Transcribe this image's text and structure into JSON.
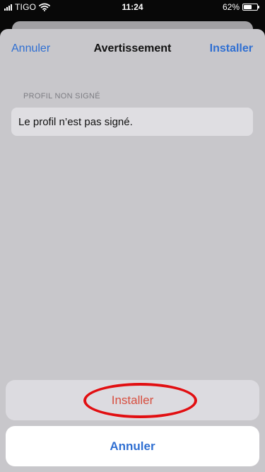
{
  "status_bar": {
    "carrier": "TIGO",
    "time": "11:24",
    "battery": "62%",
    "battery_level": 0.62,
    "signal_icon": "signal-bars-icon",
    "wifi_icon": "wifi-icon",
    "battery_icon": "battery-icon"
  },
  "navigation": {
    "left_button": "Annuler",
    "title": "Avertissement",
    "right_button": "Installer"
  },
  "content": {
    "section_header": "PROFIL NON SIGNÉ",
    "message": "Le profil n’est pas signé."
  },
  "action_sheet": {
    "primary_action": "Installer",
    "cancel_action": "Annuler"
  },
  "colors": {
    "accent": "#2F6FD2",
    "destructive": "#D74E3F",
    "highlight": "#E10F12",
    "sheet_background": "#C8C7CB"
  }
}
